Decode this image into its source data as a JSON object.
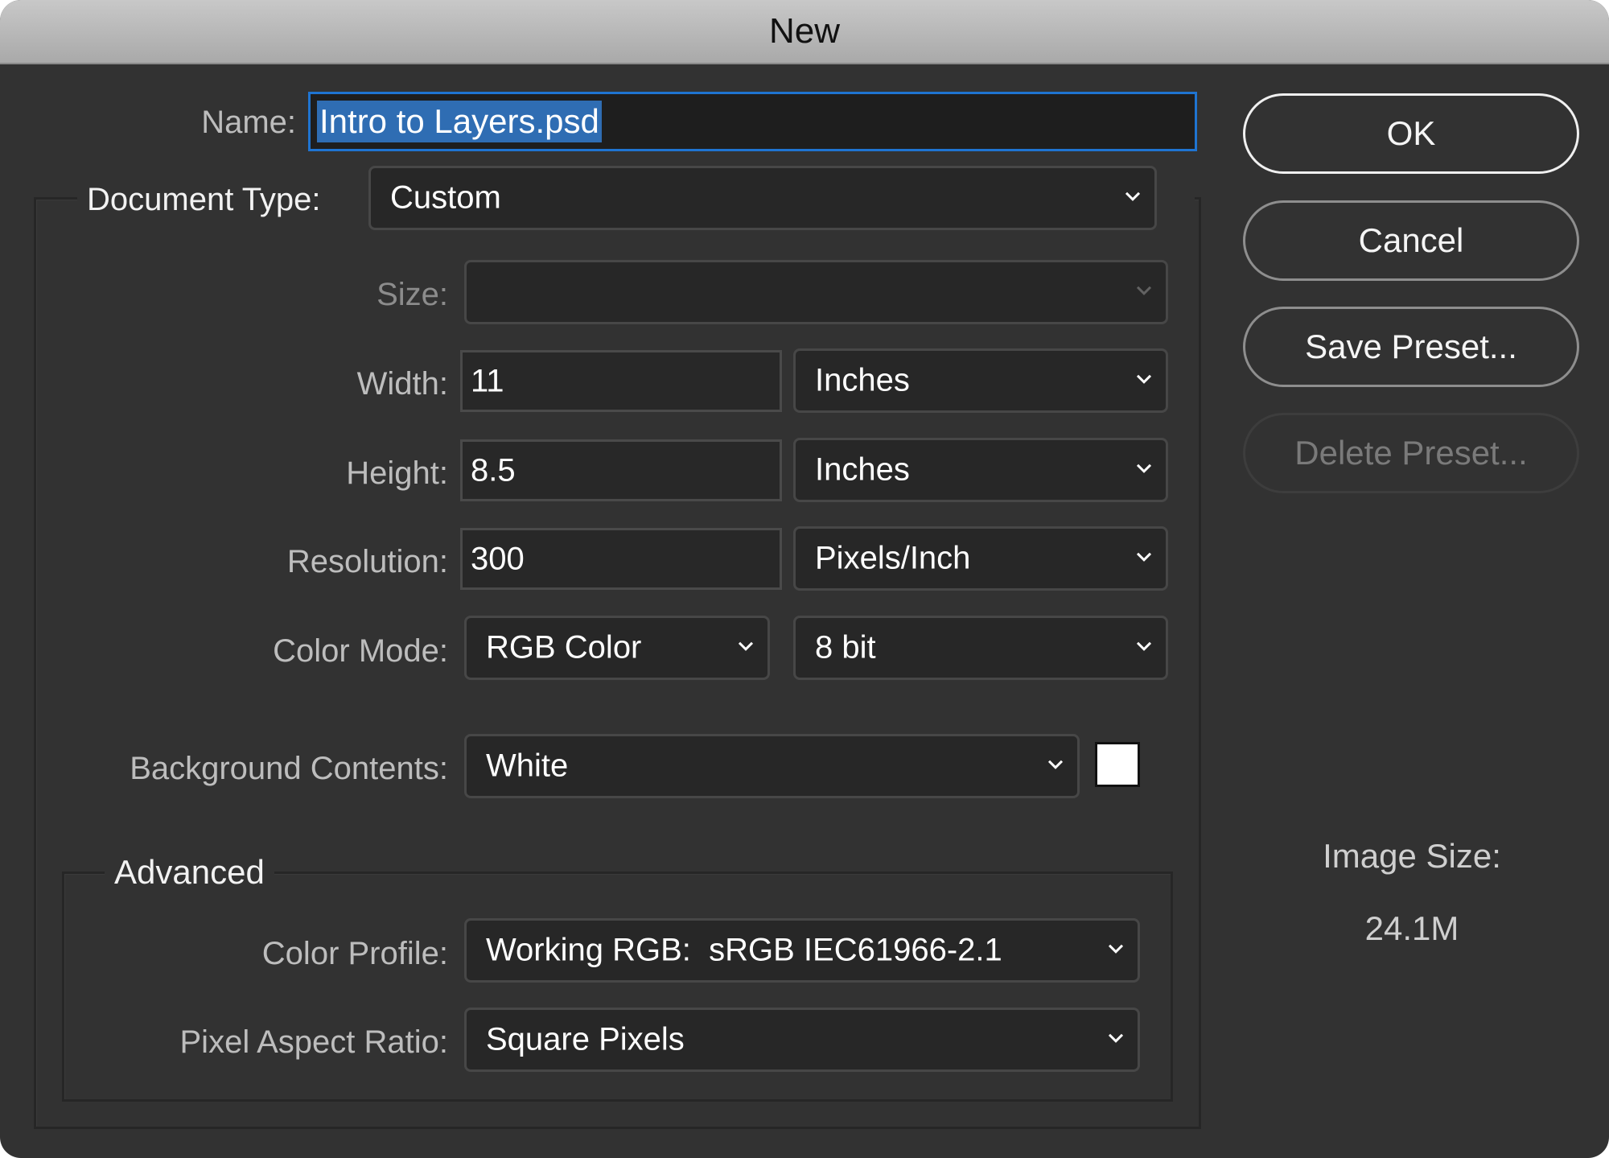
{
  "window": {
    "title": "New"
  },
  "form": {
    "name": {
      "label": "Name:",
      "value": "Intro to Layers.psd"
    },
    "document_type": {
      "label": "Document Type:",
      "value": "Custom"
    },
    "size": {
      "label": "Size:",
      "value": ""
    },
    "width": {
      "label": "Width:",
      "value": "11",
      "unit": "Inches"
    },
    "height": {
      "label": "Height:",
      "value": "8.5",
      "unit": "Inches"
    },
    "resolution": {
      "label": "Resolution:",
      "value": "300",
      "unit": "Pixels/Inch"
    },
    "color_mode": {
      "label": "Color Mode:",
      "value": "RGB Color",
      "bit_depth": "8 bit"
    },
    "background_contents": {
      "label": "Background Contents:",
      "value": "White",
      "swatch_color": "#ffffff"
    }
  },
  "advanced": {
    "title": "Advanced",
    "color_profile": {
      "label": "Color Profile:",
      "value": "Working RGB:  sRGB IEC61966-2.1"
    },
    "pixel_aspect_ratio": {
      "label": "Pixel Aspect Ratio:",
      "value": "Square Pixels"
    }
  },
  "buttons": {
    "ok": "OK",
    "cancel": "Cancel",
    "save_preset": "Save Preset...",
    "delete_preset": "Delete Preset..."
  },
  "image_size": {
    "label": "Image Size:",
    "value": "24.1M"
  },
  "colors": {
    "focus_ring": "#1f74d1",
    "selection": "#2f6db3",
    "background": "#323232"
  }
}
